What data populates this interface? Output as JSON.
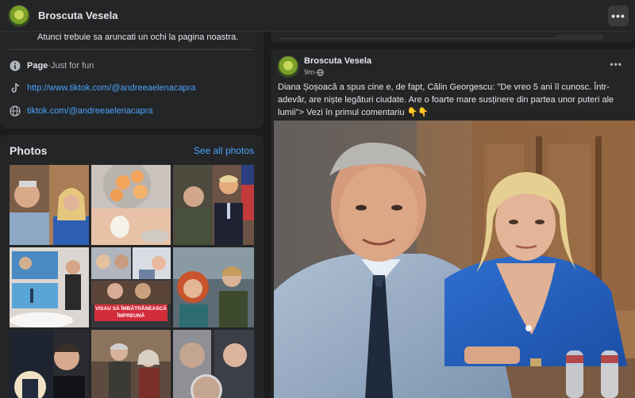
{
  "topbar": {
    "page_name": "Broscuta Vesela",
    "more_label": "•••"
  },
  "intro": {
    "tagline": "Atunci trebuie sa aruncati un ochi la pagina noastra.",
    "category_label": "Page",
    "category_sep": " · ",
    "category_value": "Just for fun",
    "links": [
      "http://www.tiktok.com/@andreeaelenacapra",
      "tiktok.com/@andreeaelenacapra"
    ]
  },
  "photos": {
    "title": "Photos",
    "see_all": "See all photos",
    "overlay_text": "VISAU SĂ ÎMBĂTRÂNEASCĂ ÎMPREUNĂ"
  },
  "post": {
    "author": "Broscuta Vesela",
    "time": "9m",
    "time_sep": " · ",
    "more_label": "•••",
    "text": "Diana Șoșoacă a spus cine e, de fapt, Călin Georgescu: \"De vreo 5 ani îl cunosc. Într-adevăr, are niște legături ciudate. Are o foarte mare susținere din partea unor puteri ale lumii\"> Vezi în primul comentariu 👇👇"
  },
  "icons": {
    "info": "info-icon",
    "tiktok": "tiktok-icon",
    "globe": "globe-icon",
    "public": "globe-small-icon",
    "more": "more-dots-icon"
  },
  "colors": {
    "background": "#1c1c1d",
    "card": "#242526",
    "link": "#4aa3ff",
    "text": "#e4e6eb",
    "muted": "#b0b3b8"
  }
}
